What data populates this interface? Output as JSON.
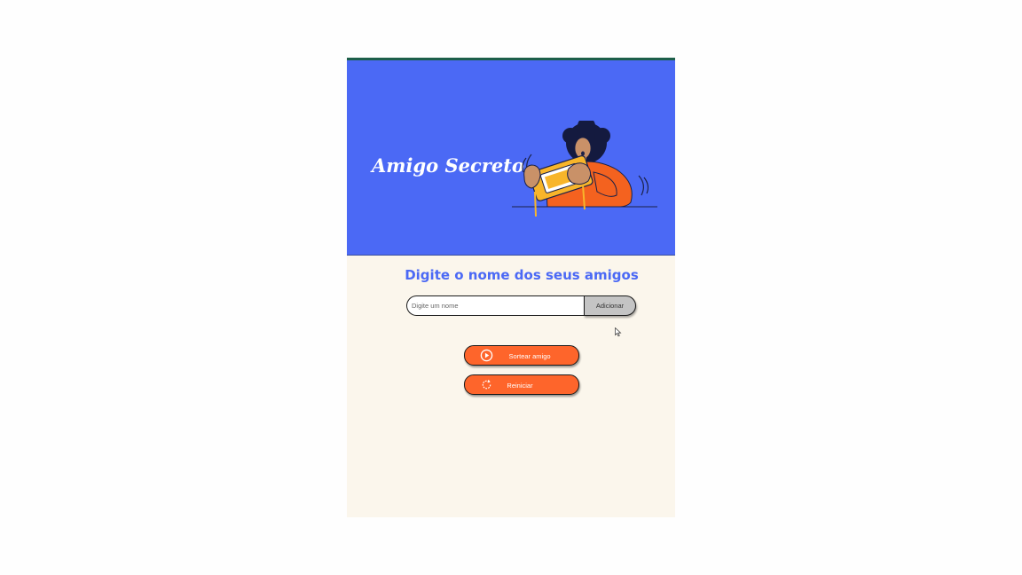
{
  "header": {
    "title": "Amigo Secreto",
    "illustration": "person-playing-handheld-game-illustration"
  },
  "colors": {
    "header_bg": "#4b69f5",
    "top_accent": "#1d5f4a",
    "page_bg": "#fbf6ec",
    "action_button_bg": "#fe652b",
    "add_button_bg": "#c4c4c4",
    "subtitle": "#4b69f5"
  },
  "main": {
    "subtitle": "Digite o nome dos seus amigos",
    "name_input": {
      "placeholder": "Digite um nome",
      "value": ""
    },
    "add_button_label": "Adicionar",
    "draw_button": {
      "label": "Sortear amigo",
      "icon": "play-circle-icon"
    },
    "reset_button": {
      "label": "Reiniciar",
      "icon": "refresh-icon"
    }
  }
}
